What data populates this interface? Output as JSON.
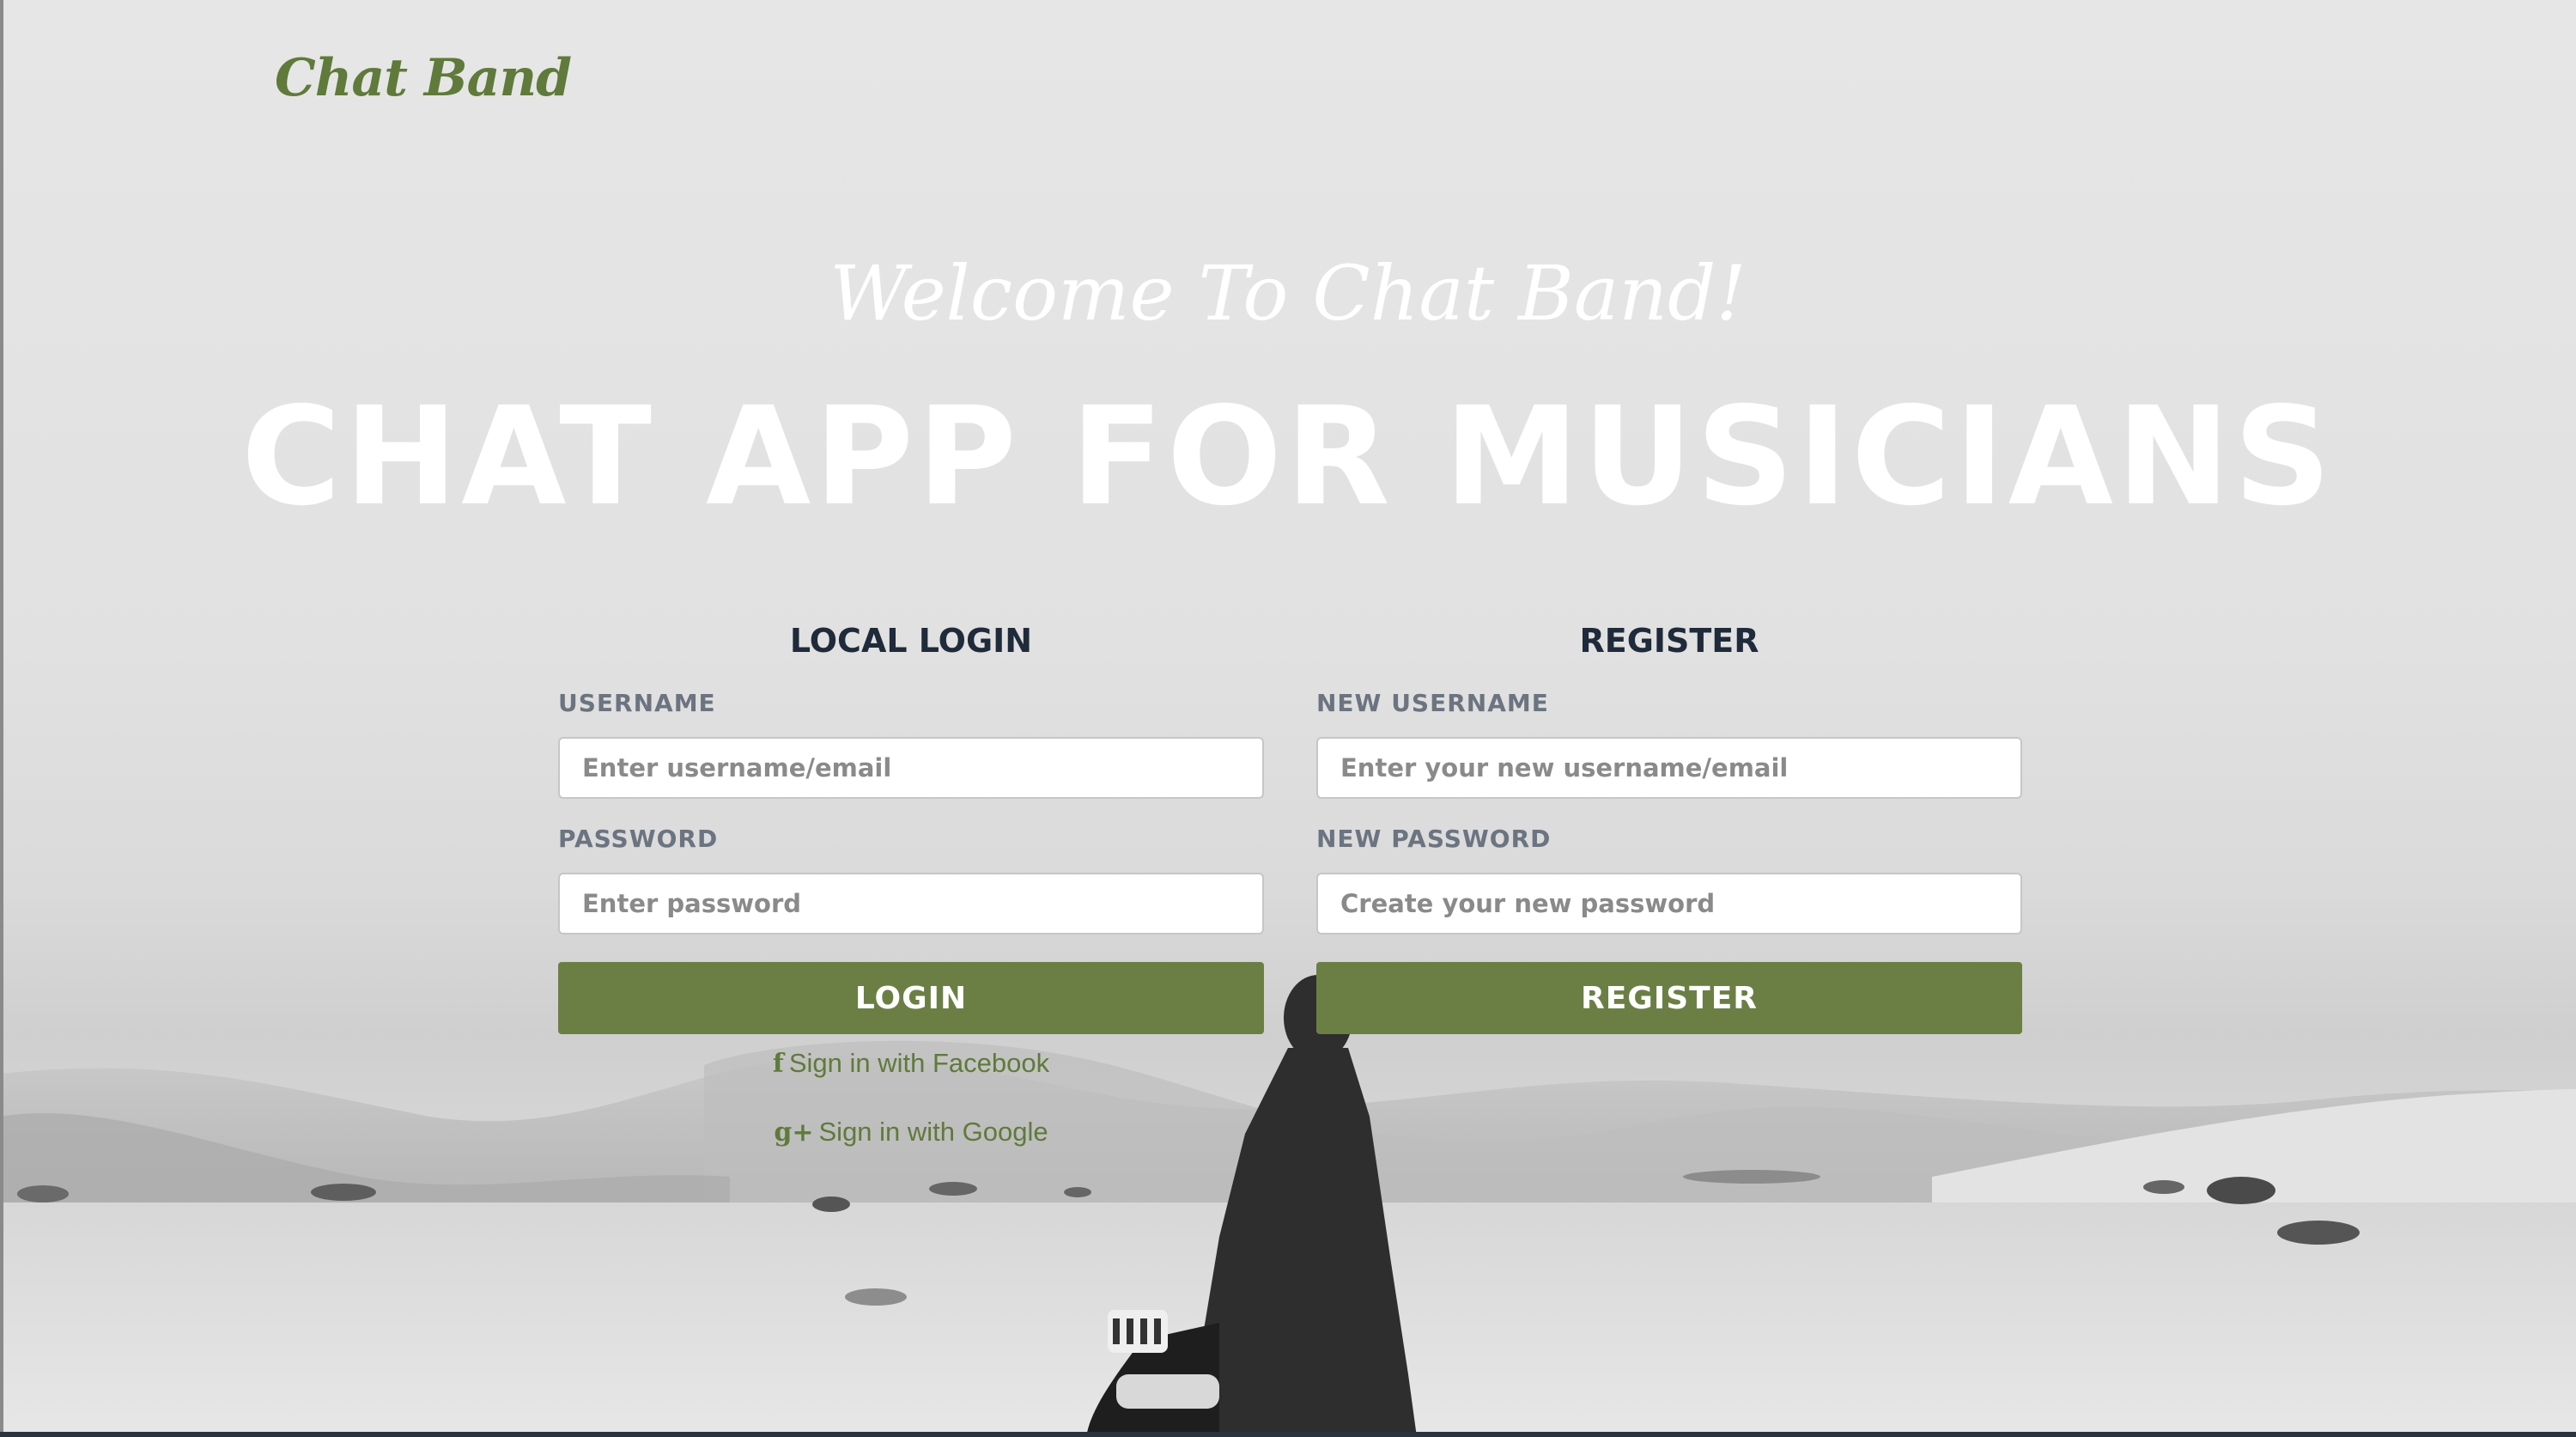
{
  "app": {
    "logo": "Chat Band"
  },
  "hero": {
    "welcome": "Welcome To Chat Band!",
    "headline": "CHAT APP FOR MUSICIANS"
  },
  "login": {
    "title": "LOCAL LOGIN",
    "username_label": "USERNAME",
    "username_placeholder": "Enter username/email",
    "password_label": "PASSWORD",
    "password_placeholder": "Enter password",
    "button": "LOGIN",
    "facebook": "Sign in with Facebook",
    "google": "Sign in with Google"
  },
  "register": {
    "title": "REGISTER",
    "username_label": "NEW USERNAME",
    "username_placeholder": "Enter your new username/email",
    "password_label": "NEW PASSWORD",
    "password_placeholder": "Create your new password",
    "button": "REGISTER"
  },
  "colors": {
    "brand_green": "#6b7f45",
    "logo_green": "#5f7a3a",
    "heading_navy": "#1f2a3a",
    "label_gray": "#6b7480"
  },
  "icons": {
    "facebook": "facebook-icon",
    "google_plus": "google-plus-icon"
  }
}
